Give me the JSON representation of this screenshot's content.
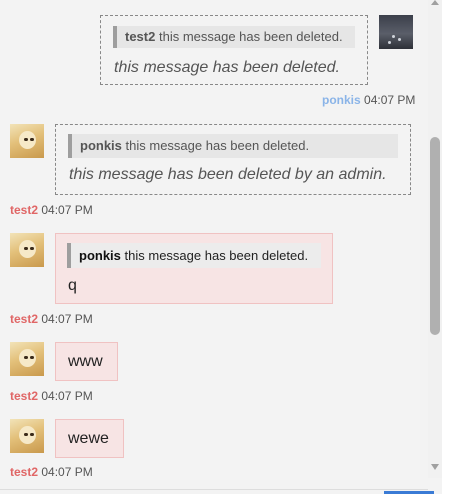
{
  "messages": [
    {
      "side": "right",
      "author": "ponkis",
      "time": "04:07 PM",
      "quote": {
        "name": "test2",
        "text": "this message has been deleted."
      },
      "body": "this message has been deleted.",
      "deleted": true
    },
    {
      "side": "left",
      "author": "test2",
      "time": "04:07 PM",
      "quote": {
        "name": "ponkis",
        "text": "this message has been deleted."
      },
      "body": "this message has been deleted by an admin.",
      "deleted": true
    },
    {
      "side": "left",
      "author": "test2",
      "time": "04:07 PM",
      "quote": {
        "name": "ponkis",
        "text": "this message has been deleted."
      },
      "body": "q",
      "deleted": false
    },
    {
      "side": "left",
      "author": "test2",
      "time": "04:07 PM",
      "body": "www",
      "deleted": false
    },
    {
      "side": "left",
      "author": "test2",
      "time": "04:07 PM",
      "body": "wewe",
      "deleted": false
    }
  ],
  "colors": {
    "own_name": "#8ab4e8",
    "other_name": "#e06666",
    "bubble_bg": "#f7e4e4",
    "bubble_border": "#f0c2c2"
  }
}
